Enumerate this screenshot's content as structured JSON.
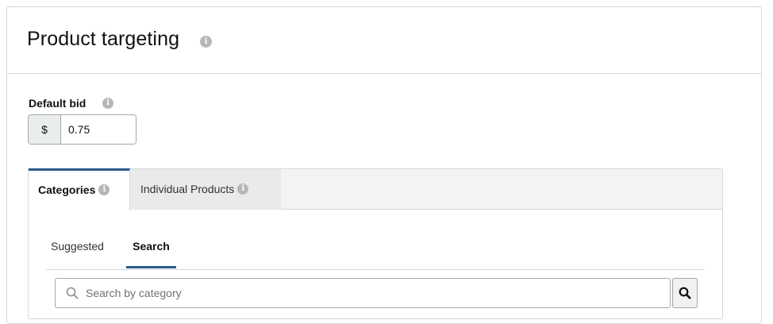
{
  "panel": {
    "title": "Product targeting",
    "title_info_icon": "info-icon"
  },
  "default_bid": {
    "label": "Default bid",
    "currency_symbol": "$",
    "value": "0.75"
  },
  "tabs": [
    {
      "label": "Categories",
      "active": true
    },
    {
      "label": "Individual Products",
      "active": false
    }
  ],
  "subtabs": [
    {
      "label": "Suggested",
      "active": false
    },
    {
      "label": "Search",
      "active": true
    }
  ],
  "search": {
    "placeholder": "Search by category",
    "value": "",
    "button_icon": "search-icon"
  },
  "colors": {
    "accent": "#2a5a8c",
    "border": "#d5d9d9",
    "tab_bar_bg": "#f3f3f3"
  }
}
